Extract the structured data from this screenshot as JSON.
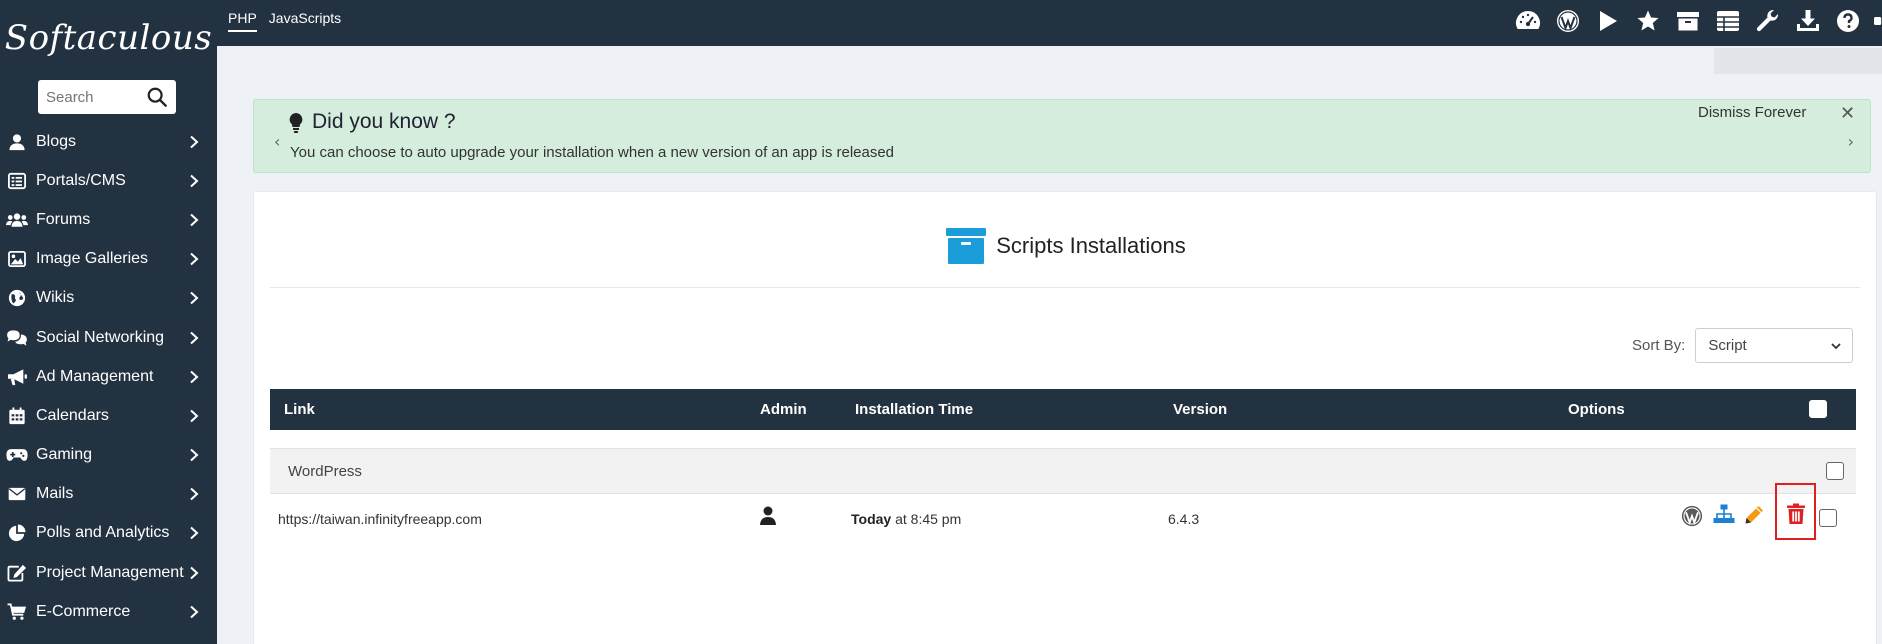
{
  "sidebar": {
    "logo": "Softaculous",
    "search_placeholder": "Search",
    "items": [
      {
        "label": "Blogs",
        "icon": "user-icon"
      },
      {
        "label": "Portals/CMS",
        "icon": "list-icon"
      },
      {
        "label": "Forums",
        "icon": "users-icon"
      },
      {
        "label": "Image Galleries",
        "icon": "image-icon"
      },
      {
        "label": "Wikis",
        "icon": "globe-icon"
      },
      {
        "label": "Social Networking",
        "icon": "comments-icon"
      },
      {
        "label": "Ad Management",
        "icon": "bullhorn-icon"
      },
      {
        "label": "Calendars",
        "icon": "calendar-icon"
      },
      {
        "label": "Gaming",
        "icon": "gamepad-icon"
      },
      {
        "label": "Mails",
        "icon": "envelope-icon"
      },
      {
        "label": "Polls and Analytics",
        "icon": "pie-chart-icon"
      },
      {
        "label": "Project Management",
        "icon": "edit-icon"
      },
      {
        "label": "E-Commerce",
        "icon": "cart-icon"
      }
    ]
  },
  "topbar": {
    "tabs": [
      {
        "label": "PHP",
        "active": true
      },
      {
        "label": "JavaScripts",
        "active": false
      }
    ],
    "icons": [
      "dashboard-icon",
      "wordpress-icon",
      "play-icon",
      "star-icon",
      "archive-icon",
      "table-icon",
      "wrench-icon",
      "download-icon",
      "help-icon"
    ]
  },
  "notice": {
    "title": "Did you know ?",
    "message": "You can choose to auto upgrade your installation when a new version of an app is released",
    "dismiss": "Dismiss Forever",
    "close": "✕"
  },
  "main": {
    "title": "Scripts Installations",
    "sort_label": "Sort By:",
    "sort_value": "Script",
    "columns": {
      "link": "Link",
      "admin": "Admin",
      "installation_time": "Installation Time",
      "version": "Version",
      "options": "Options"
    },
    "group": "WordPress",
    "rows": [
      {
        "link": "https://taiwan.infinityfreeapp.com",
        "time_bold": "Today",
        "time_rest": " at 8:45 pm",
        "version": "6.4.3"
      }
    ]
  },
  "colors": {
    "navy": "#233241",
    "notice_bg": "#d4eddc",
    "accent_blue": "#1b9dd9",
    "edit_orange": "#f39c12",
    "delete_red": "#e02020"
  }
}
